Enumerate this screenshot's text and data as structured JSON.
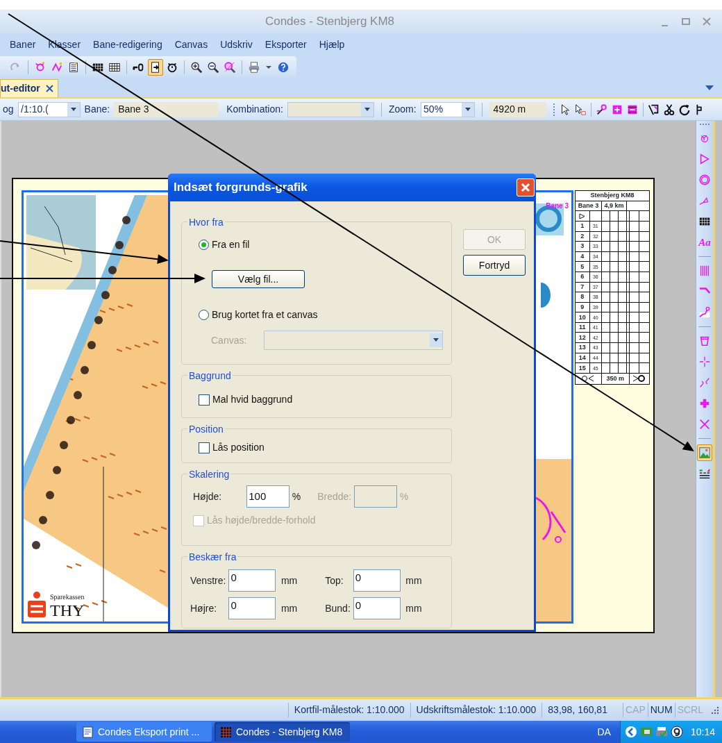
{
  "window": {
    "title": "Condes - Stenbjerg KM8"
  },
  "menu": [
    "Baner",
    "Klasser",
    "Bane-redigering",
    "Canvas",
    "Udskriv",
    "Eksporter",
    "Hjælp"
  ],
  "toolbar": [
    [
      {
        "kind": "redo",
        "selected": false
      }
    ],
    [
      {
        "kind": "course",
        "selected": false
      },
      {
        "kind": "course2",
        "selected": false
      },
      {
        "kind": "sheet",
        "selected": false
      }
    ],
    [
      {
        "kind": "grid-dark",
        "selected": false
      },
      {
        "kind": "grid",
        "selected": false
      }
    ],
    [
      {
        "kind": "key",
        "selected": false
      },
      {
        "kind": "fit",
        "selected": true
      },
      {
        "kind": "timer",
        "selected": false
      }
    ],
    [
      {
        "kind": "zoom-in",
        "selected": false
      },
      {
        "kind": "zoom-out",
        "selected": false
      },
      {
        "kind": "zoom-fit",
        "selected": false
      }
    ],
    [
      {
        "kind": "print",
        "selected": false
      },
      {
        "kind": "help",
        "selected": false
      }
    ]
  ],
  "tabs": [
    {
      "label": "ut-editor",
      "selected": true
    }
  ],
  "layout_bar": {
    "scale_label": "og",
    "scale_value": "/1:10.(",
    "course_label": "Bane:",
    "course_value": "Bane 3",
    "combination_label": "Kombination:",
    "zoom_label": "Zoom:",
    "zoom_value": "50%",
    "length": "4920 m",
    "tools": [
      [
        {
          "kind": "pointer",
          "selected": false
        },
        {
          "kind": "pointer-box",
          "selected": false
        }
      ],
      [
        {
          "kind": "pin",
          "selected": false
        },
        {
          "kind": "add-box",
          "selected": false
        },
        {
          "kind": "remove-box",
          "selected": false
        }
      ],
      [
        {
          "kind": "edit",
          "selected": false
        },
        {
          "kind": "scissors",
          "selected": false
        },
        {
          "kind": "rotate",
          "selected": false
        },
        {
          "kind": "cut",
          "selected": false
        }
      ]
    ]
  },
  "side_toolbar": [
    [
      {
        "kind": "start",
        "selected": false
      },
      {
        "kind": "triangle",
        "selected": false
      },
      {
        "kind": "circle",
        "selected": false
      },
      {
        "kind": "gauge",
        "selected": false
      },
      {
        "kind": "grid-dark",
        "selected": false
      },
      {
        "kind": "text",
        "label": "Aa",
        "selected": false
      }
    ],
    [
      {
        "kind": "hatch",
        "selected": false
      },
      {
        "kind": "bend",
        "selected": false
      },
      {
        "kind": "route",
        "selected": false
      }
    ],
    [
      {
        "kind": "cup",
        "selected": false
      },
      {
        "kind": "cross-thin",
        "selected": false
      },
      {
        "kind": "crossing",
        "selected": false
      },
      {
        "kind": "plus",
        "selected": false
      },
      {
        "kind": "x",
        "selected": false
      }
    ],
    [
      {
        "kind": "image",
        "selected": true
      },
      {
        "kind": "legend",
        "selected": false
      }
    ]
  ],
  "map": {
    "course_label": "Bane 3",
    "logo_small": "Sparekassen",
    "logo_big": "THY",
    "control_table": {
      "title": "Stenbjerg KM8",
      "course": "Bane 3",
      "length": "4,9 km",
      "rows": [
        {
          "number": "1",
          "code": "31"
        },
        {
          "number": "2",
          "code": "32"
        },
        {
          "number": "3",
          "code": "33"
        },
        {
          "number": "4",
          "code": "34"
        },
        {
          "number": "5",
          "code": "35"
        },
        {
          "number": "6",
          "code": "36"
        },
        {
          "number": "7",
          "code": "37"
        },
        {
          "number": "8",
          "code": "38"
        },
        {
          "number": "9",
          "code": "39"
        },
        {
          "number": "10",
          "code": "40"
        },
        {
          "number": "11",
          "code": "41"
        },
        {
          "number": "12",
          "code": "42"
        },
        {
          "number": "13",
          "code": "43"
        },
        {
          "number": "14",
          "code": "44"
        },
        {
          "number": "15",
          "code": "45"
        }
      ],
      "finish_distance": "350 m"
    }
  },
  "dialog": {
    "title": "Indsæt forgrunds-grafik",
    "source": {
      "legend": "Hvor fra",
      "options": [
        {
          "label": "Fra en fil",
          "selected": true
        },
        {
          "label": "Brug kortet fra et canvas",
          "selected": false
        }
      ],
      "choose_button": "Vælg fil...",
      "canvas_label": "Canvas:",
      "canvas_disabled": true
    },
    "background": {
      "legend": "Baggrund",
      "label": "Mal hvid baggrund",
      "checked": false
    },
    "position": {
      "legend": "Position",
      "label": "Lås position",
      "checked": false
    },
    "scaling": {
      "legend": "Skalering",
      "height_label": "Højde:",
      "height_value": "100",
      "height_unit": "%",
      "width_label": "Bredde:",
      "width_unit": "%",
      "width_disabled": true,
      "ratio": {
        "label": "Lås højde/bredde-forhold",
        "checked": false,
        "disabled": true
      }
    },
    "crop": {
      "legend": "Beskær fra",
      "fields": [
        {
          "label": "Venstre:",
          "value": "0",
          "unit": "mm"
        },
        {
          "label": "Top:",
          "value": "0",
          "unit": "mm"
        },
        {
          "label": "Højre:",
          "value": "0",
          "unit": "mm"
        },
        {
          "label": "Bund:",
          "value": "0",
          "unit": "mm"
        }
      ]
    },
    "buttons": [
      {
        "label": "OK",
        "disabled": true
      },
      {
        "label": "Fortryd",
        "disabled": false
      }
    ]
  },
  "status_bar": {
    "fields": [
      "Kortfil-målestok: 1:10.000",
      "Udskriftsmålestok: 1:10.000",
      "83,98, 160,81"
    ],
    "indicators": [
      {
        "label": "CAP",
        "on": false
      },
      {
        "label": "NUM",
        "on": true
      },
      {
        "label": "SCRL",
        "on": false
      }
    ]
  },
  "taskbar": {
    "tasks": [
      {
        "label": "Condes Eksport print ...",
        "kind": "document",
        "selected": false
      },
      {
        "label": "Condes - Stenbjerg KM8",
        "kind": "app",
        "selected": true
      }
    ],
    "language": "DA",
    "clock": "10:14"
  }
}
